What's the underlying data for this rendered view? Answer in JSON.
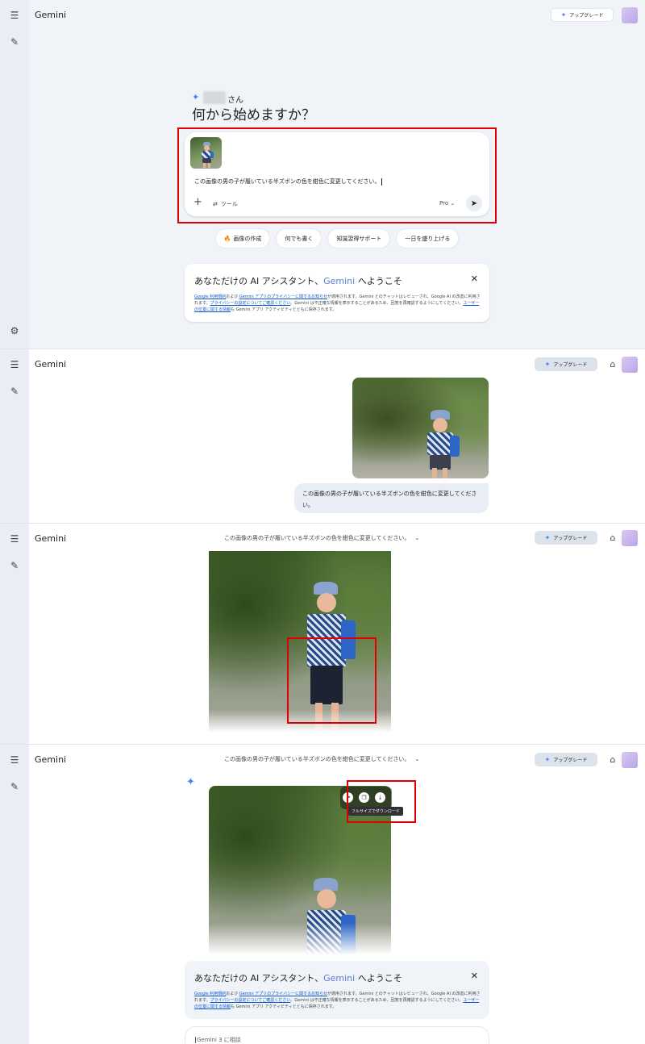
{
  "app": {
    "name": "Gemini"
  },
  "header": {
    "upgrade_label": "アップグレード",
    "upgrade_icon": "spark-icon"
  },
  "colors": {
    "rail": "#e9eef6",
    "accent": "#4285f4",
    "highlight_box": "#e00000",
    "bubble": "#e9eef6"
  },
  "home": {
    "greeting_suffix": "さん",
    "title": "何から始めますか？",
    "prompt_text": "この画像の男の子が履いている半ズボンの色を紺色に変更してください。",
    "tools_label": "ツール",
    "model_label": "Pro",
    "chips": [
      {
        "label": "画像の作成",
        "icon": "🔥"
      },
      {
        "label": "何でも書く",
        "icon": ""
      },
      {
        "label": "知識習得サポート",
        "icon": ""
      },
      {
        "label": "一日を盛り上げる",
        "icon": ""
      }
    ]
  },
  "welcome": {
    "title_prefix": "あなただけの AI アシスタント、",
    "title_brand": "Gemini",
    "title_suffix": " へようこそ",
    "body": {
      "link1": "Google 利用規約",
      "t1": "および ",
      "link2": "Gemini アプリのプライバシーに関するお知らせ",
      "t2": "が適用されます。Gemini とのチャットはレビューされ、Google AI の改善に利用されます。",
      "link3": "プライバシーの設定についてご確認ください",
      "t3": "。Gemini は不正確な情報を表示することがあるため、回答を再確認するようにしてください。",
      "link4": "ユーザーの位置に関する情報",
      "t4": "も Gemini アプリ アクティビティとともに保存されます。"
    }
  },
  "chat": {
    "user_message": "この画像の男の子が履いている半ズボンの色を紺色に変更してください。",
    "conversation_title": "この画像の男の子が履いている半ズボンの色を紺色に変更してください。",
    "download_tooltip": "フルサイズでダウンロード",
    "input_placeholder": "Gemini 3 に相談"
  }
}
